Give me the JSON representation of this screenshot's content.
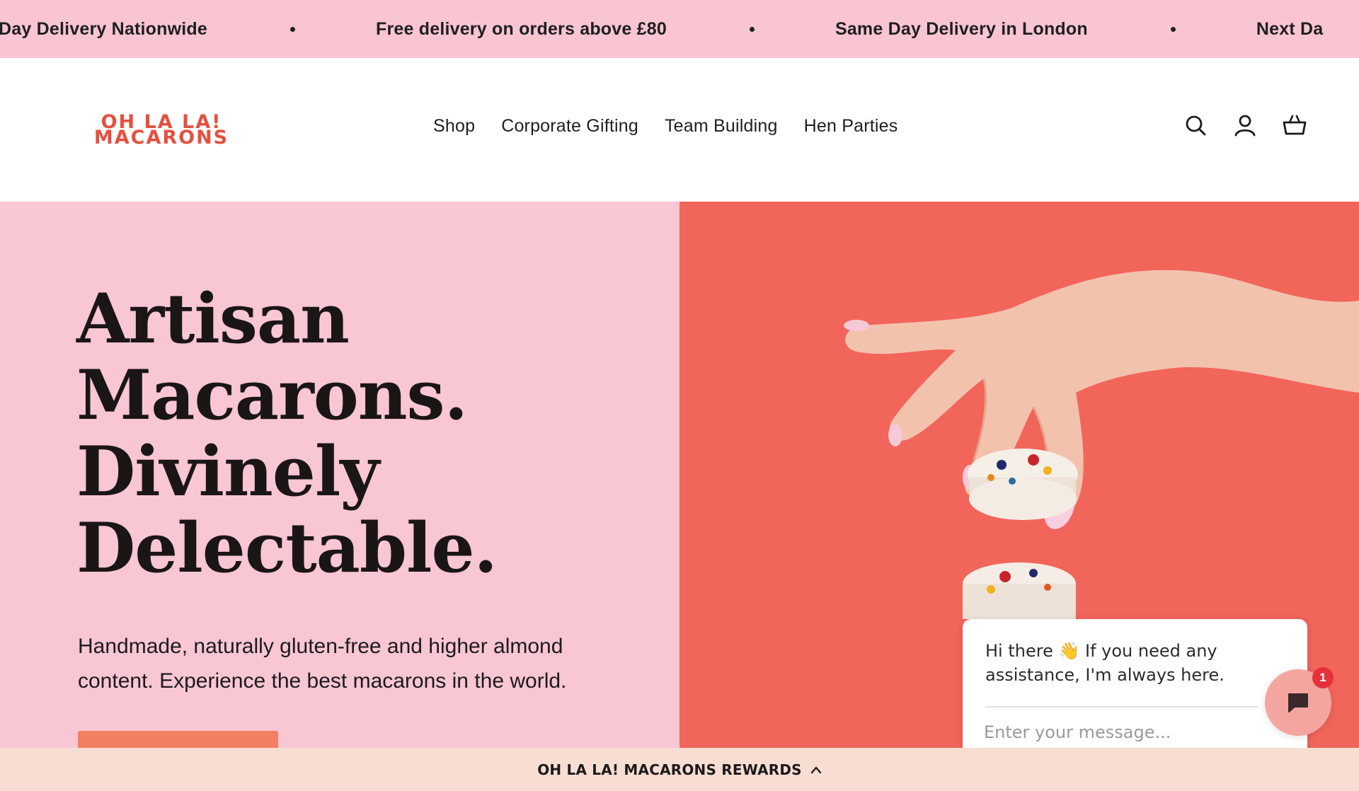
{
  "announcement": {
    "items": [
      "Day Delivery Nationwide",
      "Free delivery on orders above £80",
      "Same Day Delivery in London",
      "Next Da"
    ]
  },
  "header": {
    "logo_line1": "OH LA LA!",
    "logo_line2": "MACARONS",
    "nav": [
      "Shop",
      "Corporate Gifting",
      "Team Building",
      "Hen Parties"
    ],
    "icons": [
      "search-icon",
      "account-icon",
      "cart-icon"
    ]
  },
  "hero": {
    "title_lines": [
      "Artisan",
      "Macarons.",
      "Divinely",
      "Delectable."
    ],
    "subtitle_line1": "Handmade, naturally gluten-free and higher almond",
    "subtitle_line2": "content. Experience the best macarons in the world."
  },
  "chat": {
    "greeting_line1_a": "Hi there",
    "greeting_line1_b": "If you need any",
    "greeting_line2": "assistance, I'm always here.",
    "input_placeholder": "Enter your message...",
    "badge": "1"
  },
  "rewards": {
    "label": "OH LA LA! MACARONS REWARDS"
  },
  "colors": {
    "announce_bg": "#f9c5d3",
    "hero_left_bg": "#f9c6d3",
    "hero_right_bg": "#f2655b",
    "logo": "#e5503f",
    "cta": "#f37f62",
    "rewards_bg": "#f8ddd3",
    "badge": "#e3323b"
  }
}
